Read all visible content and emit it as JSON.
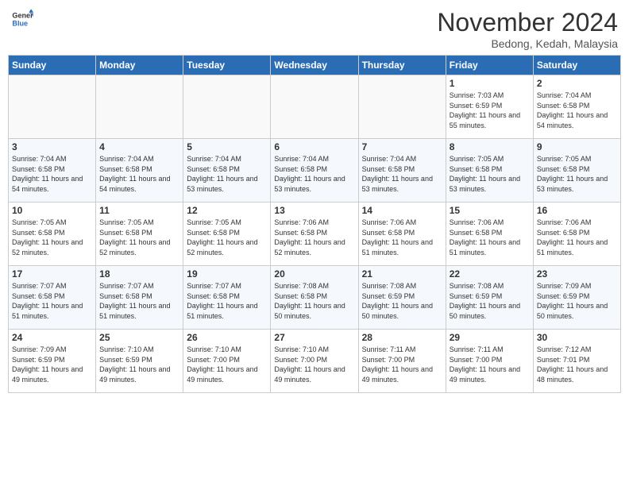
{
  "logo": {
    "line1": "General",
    "line2": "Blue"
  },
  "title": "November 2024",
  "location": "Bedong, Kedah, Malaysia",
  "days_of_week": [
    "Sunday",
    "Monday",
    "Tuesday",
    "Wednesday",
    "Thursday",
    "Friday",
    "Saturday"
  ],
  "weeks": [
    [
      {
        "day": "",
        "sunrise": "",
        "sunset": "",
        "daylight": "",
        "empty": true
      },
      {
        "day": "",
        "sunrise": "",
        "sunset": "",
        "daylight": "",
        "empty": true
      },
      {
        "day": "",
        "sunrise": "",
        "sunset": "",
        "daylight": "",
        "empty": true
      },
      {
        "day": "",
        "sunrise": "",
        "sunset": "",
        "daylight": "",
        "empty": true
      },
      {
        "day": "",
        "sunrise": "",
        "sunset": "",
        "daylight": "",
        "empty": true
      },
      {
        "day": "1",
        "sunrise": "Sunrise: 7:03 AM",
        "sunset": "Sunset: 6:59 PM",
        "daylight": "Daylight: 11 hours and 55 minutes.",
        "empty": false
      },
      {
        "day": "2",
        "sunrise": "Sunrise: 7:04 AM",
        "sunset": "Sunset: 6:58 PM",
        "daylight": "Daylight: 11 hours and 54 minutes.",
        "empty": false
      }
    ],
    [
      {
        "day": "3",
        "sunrise": "Sunrise: 7:04 AM",
        "sunset": "Sunset: 6:58 PM",
        "daylight": "Daylight: 11 hours and 54 minutes.",
        "empty": false
      },
      {
        "day": "4",
        "sunrise": "Sunrise: 7:04 AM",
        "sunset": "Sunset: 6:58 PM",
        "daylight": "Daylight: 11 hours and 54 minutes.",
        "empty": false
      },
      {
        "day": "5",
        "sunrise": "Sunrise: 7:04 AM",
        "sunset": "Sunset: 6:58 PM",
        "daylight": "Daylight: 11 hours and 53 minutes.",
        "empty": false
      },
      {
        "day": "6",
        "sunrise": "Sunrise: 7:04 AM",
        "sunset": "Sunset: 6:58 PM",
        "daylight": "Daylight: 11 hours and 53 minutes.",
        "empty": false
      },
      {
        "day": "7",
        "sunrise": "Sunrise: 7:04 AM",
        "sunset": "Sunset: 6:58 PM",
        "daylight": "Daylight: 11 hours and 53 minutes.",
        "empty": false
      },
      {
        "day": "8",
        "sunrise": "Sunrise: 7:05 AM",
        "sunset": "Sunset: 6:58 PM",
        "daylight": "Daylight: 11 hours and 53 minutes.",
        "empty": false
      },
      {
        "day": "9",
        "sunrise": "Sunrise: 7:05 AM",
        "sunset": "Sunset: 6:58 PM",
        "daylight": "Daylight: 11 hours and 53 minutes.",
        "empty": false
      }
    ],
    [
      {
        "day": "10",
        "sunrise": "Sunrise: 7:05 AM",
        "sunset": "Sunset: 6:58 PM",
        "daylight": "Daylight: 11 hours and 52 minutes.",
        "empty": false
      },
      {
        "day": "11",
        "sunrise": "Sunrise: 7:05 AM",
        "sunset": "Sunset: 6:58 PM",
        "daylight": "Daylight: 11 hours and 52 minutes.",
        "empty": false
      },
      {
        "day": "12",
        "sunrise": "Sunrise: 7:05 AM",
        "sunset": "Sunset: 6:58 PM",
        "daylight": "Daylight: 11 hours and 52 minutes.",
        "empty": false
      },
      {
        "day": "13",
        "sunrise": "Sunrise: 7:06 AM",
        "sunset": "Sunset: 6:58 PM",
        "daylight": "Daylight: 11 hours and 52 minutes.",
        "empty": false
      },
      {
        "day": "14",
        "sunrise": "Sunrise: 7:06 AM",
        "sunset": "Sunset: 6:58 PM",
        "daylight": "Daylight: 11 hours and 51 minutes.",
        "empty": false
      },
      {
        "day": "15",
        "sunrise": "Sunrise: 7:06 AM",
        "sunset": "Sunset: 6:58 PM",
        "daylight": "Daylight: 11 hours and 51 minutes.",
        "empty": false
      },
      {
        "day": "16",
        "sunrise": "Sunrise: 7:06 AM",
        "sunset": "Sunset: 6:58 PM",
        "daylight": "Daylight: 11 hours and 51 minutes.",
        "empty": false
      }
    ],
    [
      {
        "day": "17",
        "sunrise": "Sunrise: 7:07 AM",
        "sunset": "Sunset: 6:58 PM",
        "daylight": "Daylight: 11 hours and 51 minutes.",
        "empty": false
      },
      {
        "day": "18",
        "sunrise": "Sunrise: 7:07 AM",
        "sunset": "Sunset: 6:58 PM",
        "daylight": "Daylight: 11 hours and 51 minutes.",
        "empty": false
      },
      {
        "day": "19",
        "sunrise": "Sunrise: 7:07 AM",
        "sunset": "Sunset: 6:58 PM",
        "daylight": "Daylight: 11 hours and 51 minutes.",
        "empty": false
      },
      {
        "day": "20",
        "sunrise": "Sunrise: 7:08 AM",
        "sunset": "Sunset: 6:58 PM",
        "daylight": "Daylight: 11 hours and 50 minutes.",
        "empty": false
      },
      {
        "day": "21",
        "sunrise": "Sunrise: 7:08 AM",
        "sunset": "Sunset: 6:59 PM",
        "daylight": "Daylight: 11 hours and 50 minutes.",
        "empty": false
      },
      {
        "day": "22",
        "sunrise": "Sunrise: 7:08 AM",
        "sunset": "Sunset: 6:59 PM",
        "daylight": "Daylight: 11 hours and 50 minutes.",
        "empty": false
      },
      {
        "day": "23",
        "sunrise": "Sunrise: 7:09 AM",
        "sunset": "Sunset: 6:59 PM",
        "daylight": "Daylight: 11 hours and 50 minutes.",
        "empty": false
      }
    ],
    [
      {
        "day": "24",
        "sunrise": "Sunrise: 7:09 AM",
        "sunset": "Sunset: 6:59 PM",
        "daylight": "Daylight: 11 hours and 49 minutes.",
        "empty": false
      },
      {
        "day": "25",
        "sunrise": "Sunrise: 7:10 AM",
        "sunset": "Sunset: 6:59 PM",
        "daylight": "Daylight: 11 hours and 49 minutes.",
        "empty": false
      },
      {
        "day": "26",
        "sunrise": "Sunrise: 7:10 AM",
        "sunset": "Sunset: 7:00 PM",
        "daylight": "Daylight: 11 hours and 49 minutes.",
        "empty": false
      },
      {
        "day": "27",
        "sunrise": "Sunrise: 7:10 AM",
        "sunset": "Sunset: 7:00 PM",
        "daylight": "Daylight: 11 hours and 49 minutes.",
        "empty": false
      },
      {
        "day": "28",
        "sunrise": "Sunrise: 7:11 AM",
        "sunset": "Sunset: 7:00 PM",
        "daylight": "Daylight: 11 hours and 49 minutes.",
        "empty": false
      },
      {
        "day": "29",
        "sunrise": "Sunrise: 7:11 AM",
        "sunset": "Sunset: 7:00 PM",
        "daylight": "Daylight: 11 hours and 49 minutes.",
        "empty": false
      },
      {
        "day": "30",
        "sunrise": "Sunrise: 7:12 AM",
        "sunset": "Sunset: 7:01 PM",
        "daylight": "Daylight: 11 hours and 48 minutes.",
        "empty": false
      }
    ]
  ]
}
